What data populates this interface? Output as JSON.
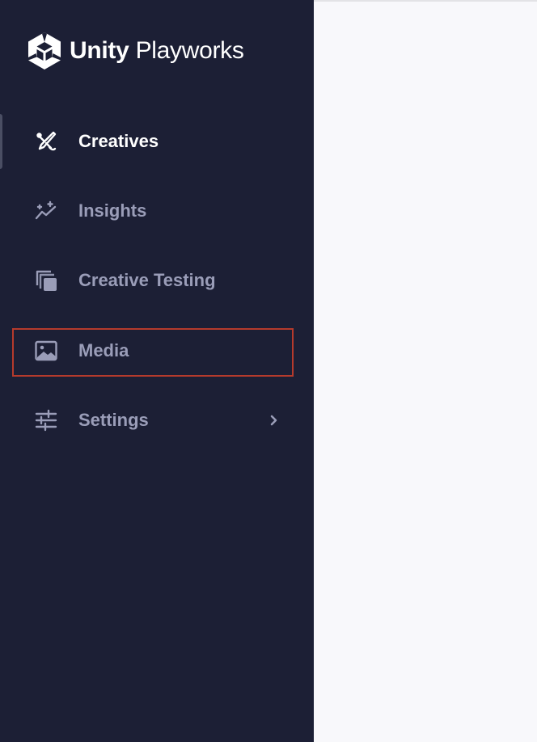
{
  "brand": {
    "name_bold": "Unity",
    "name_light": "Playworks",
    "logo_icon": "unity-cube-icon"
  },
  "colors": {
    "sidebar_bg": "#1c1f35",
    "content_bg": "#f8f8fb",
    "active_text": "#ffffff",
    "inactive_text": "#9a9db8",
    "highlight_border": "#b53a2c"
  },
  "sidebar": {
    "items": [
      {
        "label": "Creatives",
        "icon": "pen-brush-icon",
        "active": true
      },
      {
        "label": "Insights",
        "icon": "sparkle-trend-icon",
        "active": false
      },
      {
        "label": "Creative Testing",
        "icon": "stacked-copies-icon",
        "active": false
      },
      {
        "label": "Media",
        "icon": "image-icon",
        "active": false,
        "highlighted": true
      },
      {
        "label": "Settings",
        "icon": "sliders-icon",
        "active": false,
        "has_submenu": true
      }
    ]
  }
}
